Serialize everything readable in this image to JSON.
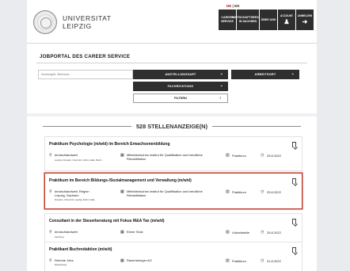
{
  "header": {
    "university_line1": "UNIVERSITAT",
    "university_line2": "LEIPZIG",
    "lang_de": "DE",
    "lang_sep": "|",
    "lang_en": "EN",
    "buttons": {
      "career_service_1": "CAREER",
      "career_service_2": "SERVICE",
      "wirtschaft_1": "WIRTSCHAFTSREGION",
      "wirtschaft_2": "IN SACHSEN",
      "ueber_uns": "ÜBER UNS",
      "account": "ACCOUNT",
      "anmelden": "ANMELDEN"
    }
  },
  "portal": {
    "title": "JOBPORTAL DES CAREER SERVICE"
  },
  "search": {
    "placeholder": "Suchbegriff, Stichwort...",
    "anstellungsart": "ANSTELLUNGSART",
    "arbeitsort": "ARBEITSORT",
    "fachrichtung": "FACHRICHTUNG",
    "filtern": "FILTERN"
  },
  "results": {
    "count": "528 STELLENANZEIGE(N)",
    "jobs": [
      {
        "title": "Praktikum Psychologie (m/w/d) im Bereich Erwachsenenbildung",
        "location": "deutschlandweit",
        "location_sub": "Leipzig, Dresden, Chemnitz, Erfurt, Halle, Berlin",
        "org_line1": "Mitteldeutsches Institut für Qualifikation und berufliche",
        "org_line2": "Rehabilitation",
        "type": "Praktikum",
        "date": "25.8.2022"
      },
      {
        "title": "Praktikum im Bereich Bildungs-/Sozialmanagement und Verwaltung (m/w/d)",
        "location": "deutschlandweit, Region",
        "location_line2": "Leipzig, Sachsen",
        "location_sub": "Dresden, Chemnitz, Leipzig, Erfurt, Halle",
        "org_line1": "Mitteldeutsches Institut für Qualifikation und berufliche",
        "org_line2": "Rehabilitation",
        "type": "Praktikum",
        "date": "25.8.2022"
      },
      {
        "title": "Consultant in der Steuerberatung mit Fokus M&A Tax (m/w/d)",
        "location": "deutschlandweit",
        "location_sub": "Hamburg",
        "org_line1": "Ebner Stolz",
        "type": "Vollzeitstelle",
        "date": "25.8.2022"
      },
      {
        "title": "Praktikant Buchredaktion (m/w/d)",
        "location": "Remote Jobs",
        "location_sub": "Ravensburg",
        "org_line1": "Ravensburger AG",
        "type": "Praktikum",
        "date": "31.8.2022"
      }
    ]
  },
  "colors": {
    "dark": "#2e2e2e",
    "accent_red": "#b5121b",
    "highlight_border": "#c0392b"
  }
}
